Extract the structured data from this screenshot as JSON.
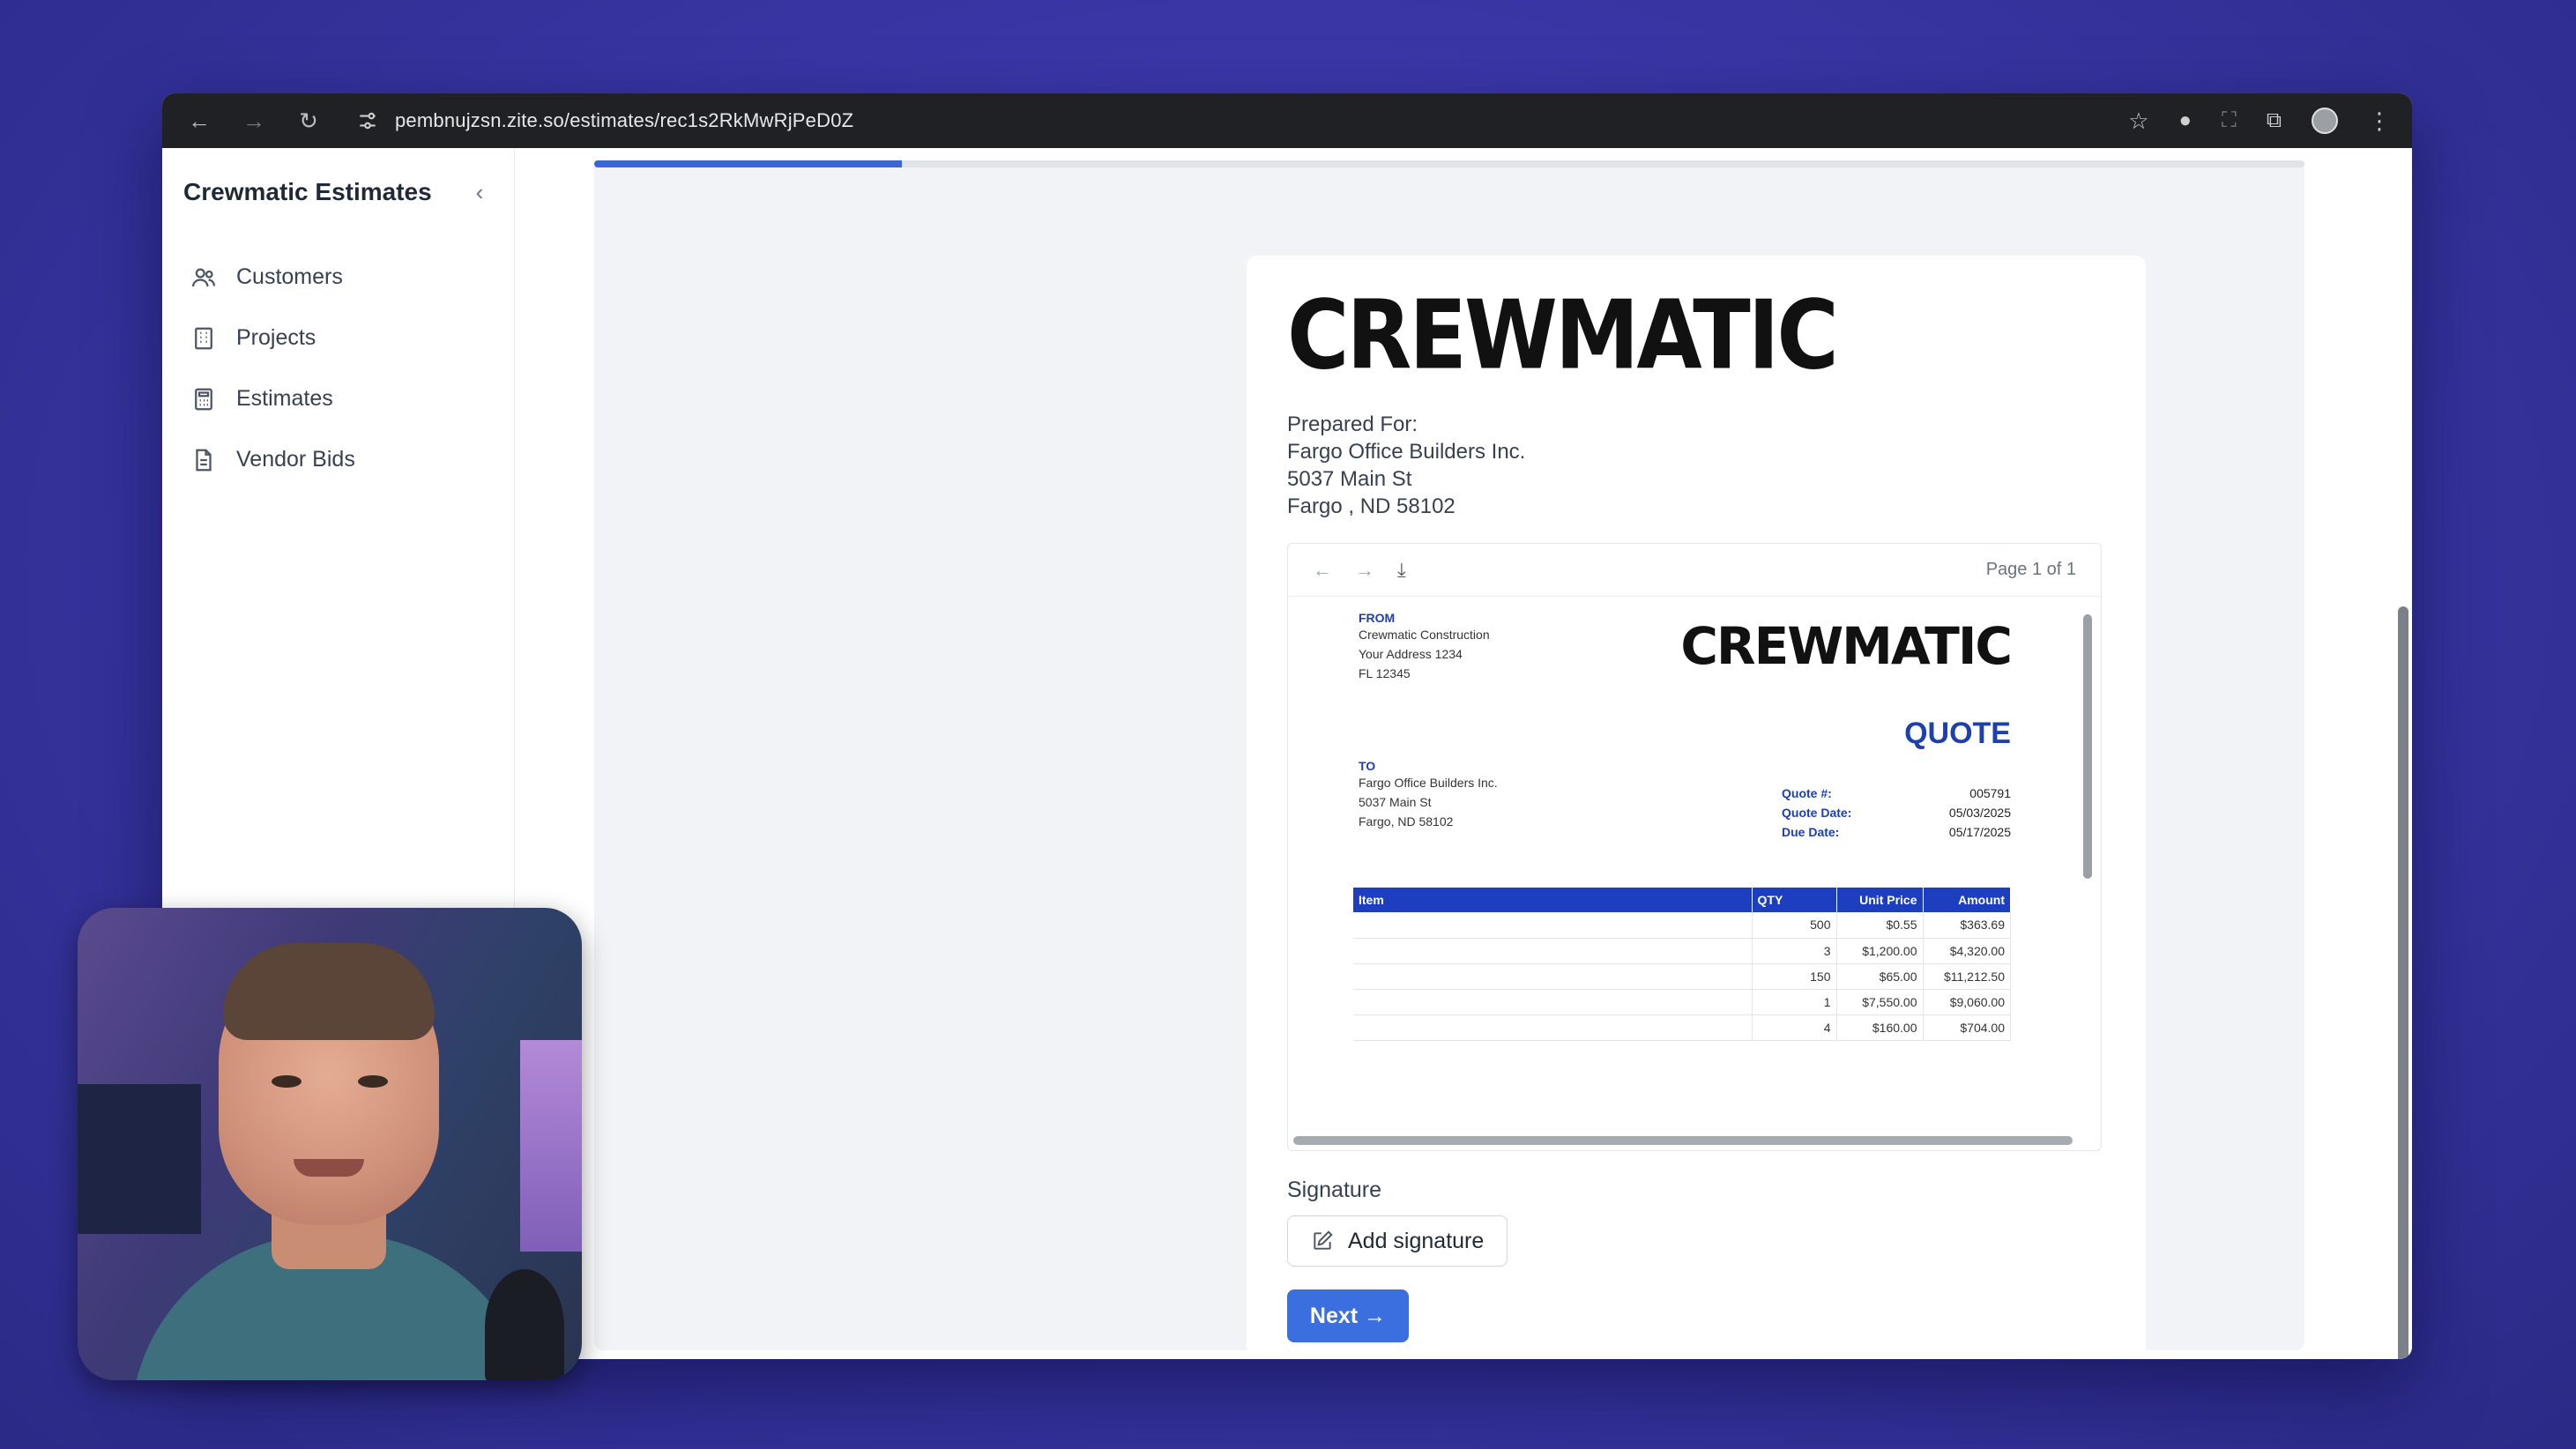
{
  "browser": {
    "url": "pembnujzsn.zite.so/estimates/rec1s2RkMwRjPeD0Z"
  },
  "sidebar": {
    "title": "Crewmatic Estimates",
    "items": [
      {
        "label": "Customers",
        "icon": "users-icon"
      },
      {
        "label": "Projects",
        "icon": "building-icon"
      },
      {
        "label": "Estimates",
        "icon": "calculator-icon"
      },
      {
        "label": "Vendor Bids",
        "icon": "document-icon"
      }
    ]
  },
  "progress": {
    "fraction": 0.18
  },
  "document": {
    "logo": "CREWMATIC",
    "prepared_for_label": "Prepared For:",
    "client_name": "Fargo Office Builders Inc.",
    "client_address": "5037 Main St",
    "client_city": "Fargo , ND  58102"
  },
  "viewer": {
    "page_indicator": "Page 1 of 1"
  },
  "quote": {
    "from_label": "FROM",
    "from_lines": [
      "Crewmatic Construction",
      "Your Address 1234",
      "FL 12345"
    ],
    "logo": "CREWMATIC",
    "title": "QUOTE",
    "to_label": "TO",
    "to_lines": [
      "Fargo Office Builders Inc.",
      "5037 Main St",
      "Fargo, ND 58102"
    ],
    "meta": [
      {
        "label": "Quote #:",
        "value": "005791"
      },
      {
        "label": "Quote Date:",
        "value": "05/03/2025"
      },
      {
        "label": "Due Date:",
        "value": "05/17/2025"
      }
    ],
    "table": {
      "headers": [
        "Item",
        "QTY",
        "Unit Price",
        "Amount"
      ],
      "rows": [
        [
          "",
          "500",
          "$0.55",
          "$363.69"
        ],
        [
          "",
          "3",
          "$1,200.00",
          "$4,320.00"
        ],
        [
          "",
          "150",
          "$65.00",
          "$11,212.50"
        ],
        [
          "",
          "1",
          "$7,550.00",
          "$9,060.00"
        ],
        [
          "",
          "4",
          "$160.00",
          "$704.00"
        ]
      ]
    }
  },
  "signature": {
    "label": "Signature",
    "add_button": "Add signature"
  },
  "next_button": "Next →",
  "colors": {
    "accent": "#3b6fe0",
    "quote_blue": "#1d3fbf",
    "background": "#3a36a6"
  }
}
